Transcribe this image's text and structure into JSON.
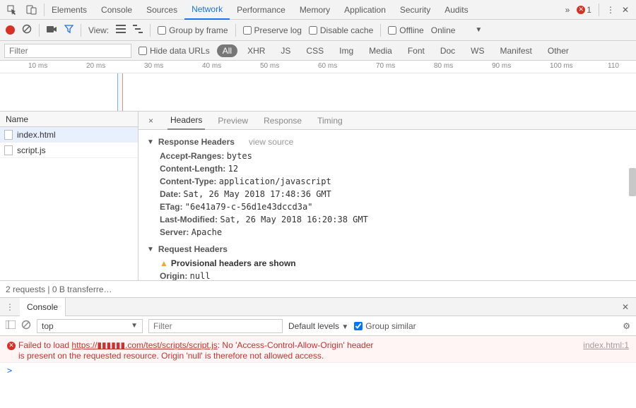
{
  "topbarTabs": [
    "Elements",
    "Console",
    "Sources",
    "Network",
    "Performance",
    "Memory",
    "Application",
    "Security",
    "Audits"
  ],
  "topActive": "Network",
  "errorCount": "1",
  "toolbar": {
    "view": "View:",
    "groupByFrame": "Group by frame",
    "preserveLog": "Preserve log",
    "disableCache": "Disable cache",
    "offline": "Offline",
    "online": "Online"
  },
  "filter": {
    "placeholder": "Filter",
    "hideData": "Hide data URLs",
    "types": [
      "All",
      "XHR",
      "JS",
      "CSS",
      "Img",
      "Media",
      "Font",
      "Doc",
      "WS",
      "Manifest",
      "Other"
    ],
    "typeActive": "All"
  },
  "timeline": {
    "ticks": [
      "10 ms",
      "20 ms",
      "30 ms",
      "40 ms",
      "50 ms",
      "60 ms",
      "70 ms",
      "80 ms",
      "90 ms",
      "100 ms",
      "110"
    ]
  },
  "reqlist": {
    "header": "Name",
    "rows": [
      "index.html",
      "script.js"
    ],
    "selected": "index.html"
  },
  "details": {
    "tabs": [
      "Headers",
      "Preview",
      "Response",
      "Timing"
    ],
    "active": "Headers",
    "respHdrTitle": "Response Headers",
    "viewSource": "view source",
    "respHeaders": [
      {
        "k": "Accept-Ranges:",
        "v": "bytes"
      },
      {
        "k": "Content-Length:",
        "v": "12"
      },
      {
        "k": "Content-Type:",
        "v": "application/javascript"
      },
      {
        "k": "Date:",
        "v": "Sat, 26 May 2018 17:48:36 GMT"
      },
      {
        "k": "ETag:",
        "v": "\"6e41a79-c-56d1e43dccd3a\""
      },
      {
        "k": "Last-Modified:",
        "v": "Sat, 26 May 2018 16:20:38 GMT"
      },
      {
        "k": "Server:",
        "v": "Apache"
      }
    ],
    "reqHdrTitle": "Request Headers",
    "provisional": "Provisional headers are shown",
    "reqHeaders": [
      {
        "k": "Origin:",
        "v": "null"
      }
    ]
  },
  "status": "2 requests | 0 B transferre…",
  "drawer": {
    "tab": "Console",
    "context": "top",
    "filterPlaceholder": "Filter",
    "levels": "Default levels",
    "groupSimilar": "Group similar"
  },
  "console": {
    "msg1a": "Failed to load ",
    "msgUrlPre": "https://",
    "msgUrlBlur": "▮▮▮▮▮▮",
    "msgUrlPost": ".com/test/scripts/script.js",
    "msg1b": ": No 'Access-Control-Allow-Origin' header",
    "msg2": "is present on the requested resource. Origin 'null' is therefore not allowed access.",
    "src": "index.html:1",
    "prompt": ">"
  }
}
